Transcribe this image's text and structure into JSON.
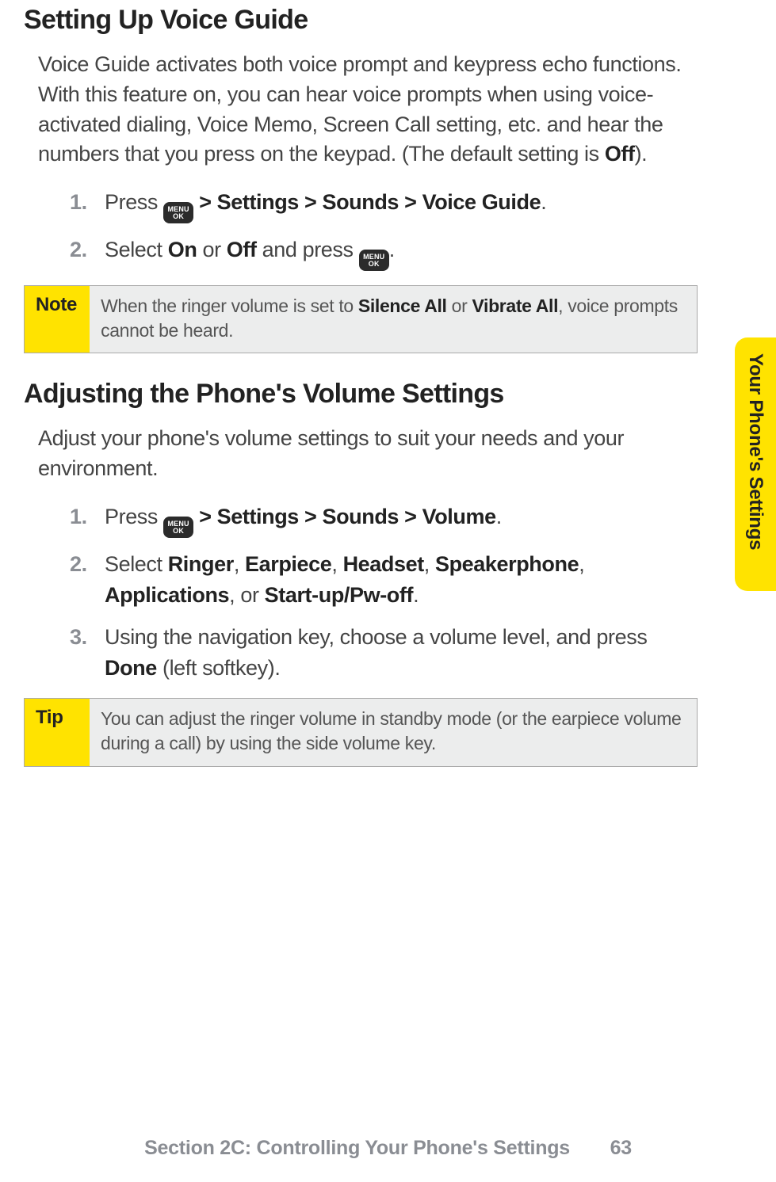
{
  "side_tab": "Your Phone's Settings",
  "section1": {
    "heading": "Setting Up Voice Guide",
    "intro_parts": [
      "Voice Guide activates both voice prompt and keypress echo functions. With this feature on, you can hear voice prompts when using voice-activated dialing, Voice Memo, Screen Call setting, etc. and hear the numbers that you press on the keypad. (The default setting is ",
      "Off",
      ")."
    ],
    "steps": [
      {
        "num": "1.",
        "pre": "Press ",
        "bold_after_key": " > Settings > Sounds > Voice Guide",
        "post": "."
      },
      {
        "num": "2.",
        "pre": "Select ",
        "b1": "On",
        "mid1": " or ",
        "b2": "Off",
        "mid2": " and press ",
        "post": "."
      }
    ],
    "note_label": "Note",
    "note_parts": [
      "When the ringer volume is set to ",
      "Silence All",
      " or ",
      "Vibrate All",
      ", voice prompts cannot be heard."
    ]
  },
  "section2": {
    "heading": "Adjusting the Phone's Volume Settings",
    "intro": "Adjust your phone's volume settings to suit your needs and your environment.",
    "steps": [
      {
        "num": "1.",
        "pre": "Press ",
        "bold_after_key": " > Settings > Sounds > Volume",
        "post": "."
      },
      {
        "num": "2.",
        "pre": "Select ",
        "b1": "Ringer",
        "c1": ", ",
        "b2": "Earpiece",
        "c2": ", ",
        "b3": "Headset",
        "c3": ", ",
        "b4": "Speakerphone",
        "c4": ", ",
        "b5": "Applications",
        "c5": ", or ",
        "b6": "Start-up/Pw-off",
        "post": "."
      },
      {
        "num": "3.",
        "pre": "Using the navigation key, choose a volume level, and press ",
        "b1": "Done",
        "post": " (left softkey)."
      }
    ],
    "tip_label": "Tip",
    "tip_text": "You can adjust the ringer volume in standby mode (or the earpiece volume during a call) by using the side volume key."
  },
  "key_label_top": "MENU",
  "key_label_bottom": "OK",
  "footer": {
    "text": "Section 2C: Controlling Your Phone's Settings",
    "page": "63"
  }
}
